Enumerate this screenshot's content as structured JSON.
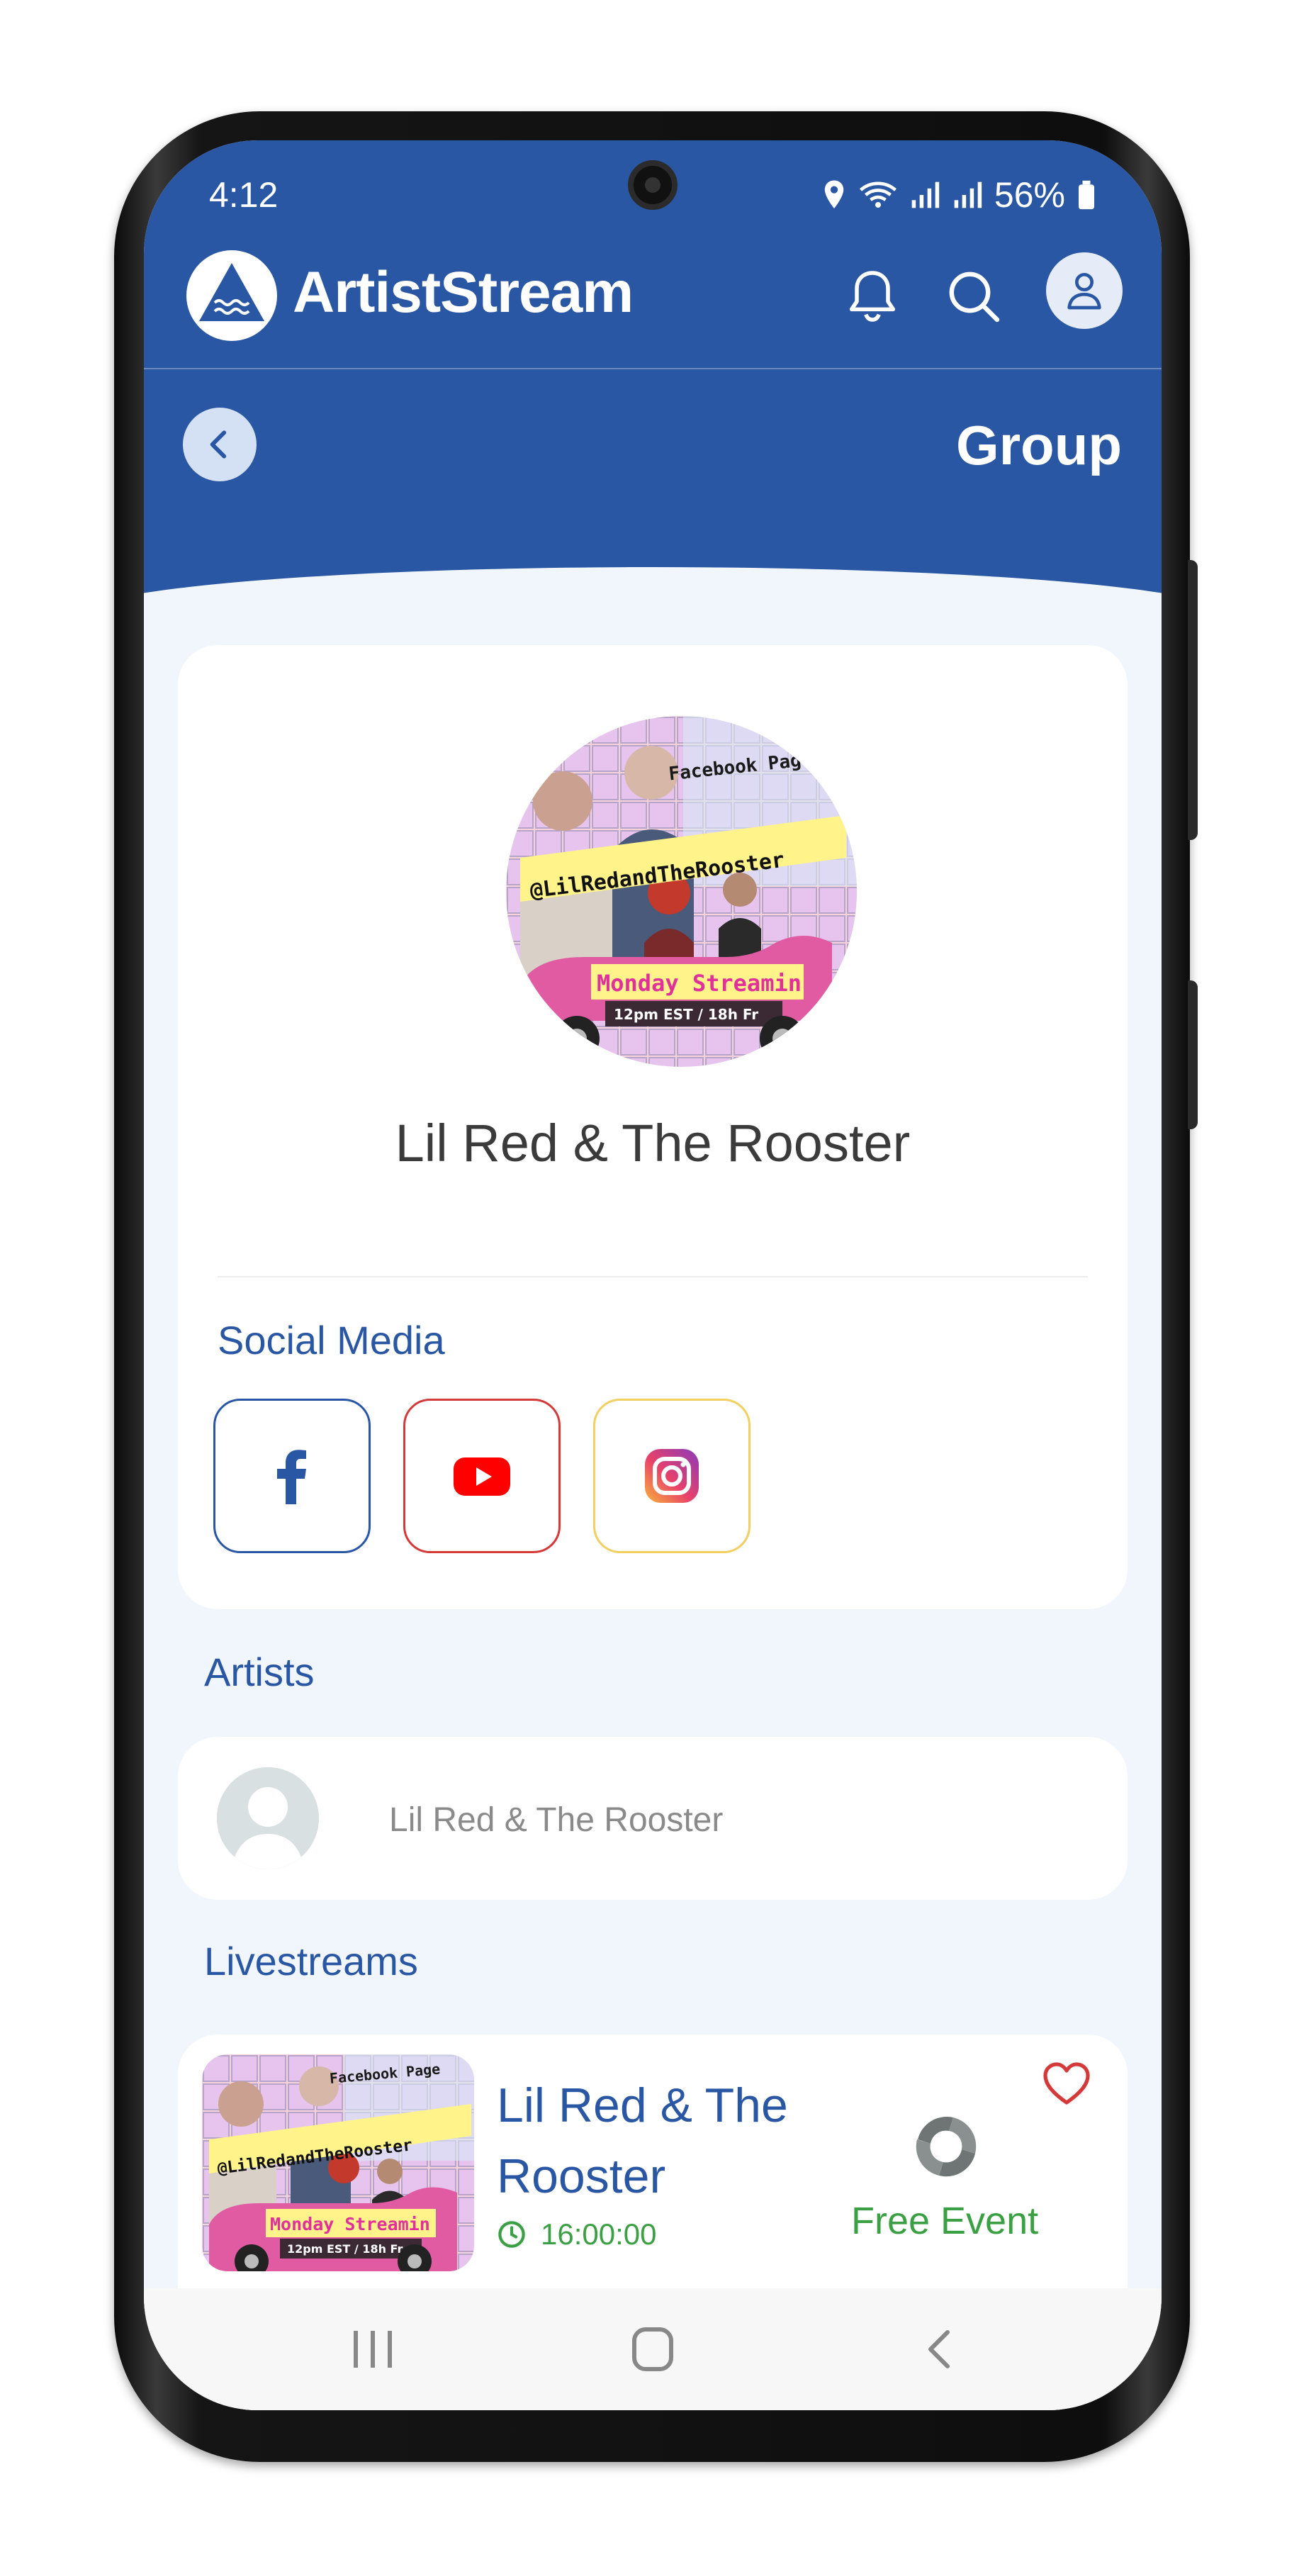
{
  "status_bar": {
    "time": "4:12",
    "battery": "56%"
  },
  "app": {
    "name": "ArtistStream"
  },
  "header": {
    "title": "Group"
  },
  "group": {
    "name": "Lil Red & The Rooster",
    "image": {
      "top_text": "Facebook Page",
      "handle": "@LilRedandTheRooster",
      "banner": "Monday Streamin",
      "schedule": "12pm EST / 18h Fr"
    }
  },
  "social": {
    "label": "Social Media",
    "links": [
      {
        "name": "facebook",
        "icon": "facebook-icon",
        "color": "#2a57a3"
      },
      {
        "name": "youtube",
        "icon": "youtube-icon",
        "color": "#d43a3a"
      },
      {
        "name": "instagram",
        "icon": "instagram-icon",
        "color": "#f2cf63"
      }
    ]
  },
  "artists": {
    "label": "Artists",
    "items": [
      {
        "name": "Lil Red & The Rooster"
      }
    ]
  },
  "livestreams": {
    "label": "Livestreams",
    "items": [
      {
        "title": "Lil Red & The Rooster",
        "time": "16:00:00",
        "price": "Free Event"
      }
    ]
  },
  "colors": {
    "primary": "#2a57a3",
    "background": "#f1f6fd",
    "accent_green": "#3aa043",
    "heart_red": "#d43a3a"
  }
}
